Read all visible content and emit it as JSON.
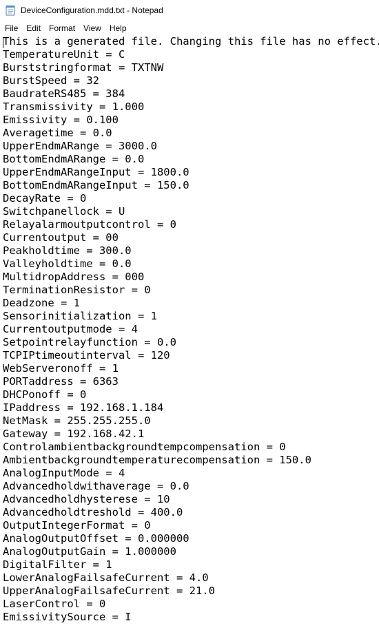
{
  "window": {
    "title": "DeviceConfiguration.mdd.txt - Notepad",
    "icon": "notepad-icon"
  },
  "menu": {
    "items": [
      "File",
      "Edit",
      "Format",
      "View",
      "Help"
    ]
  },
  "document": {
    "lines": [
      "This is a generated file. Changing this file has no effect.",
      "TemperatureUnit = C",
      "Burststringformat = TXTNW",
      "BurstSpeed = 32",
      "BaudrateRS485 = 384",
      "Transmissivity = 1.000",
      "Emissivity = 0.100",
      "Averagetime = 0.0",
      "UpperEndmARange = 3000.0",
      "BottomEndmARange = 0.0",
      "UpperEndmARangeInput = 1800.0",
      "BottomEndmARangeInput = 150.0",
      "DecayRate = 0",
      "Switchpanellock = U",
      "Relayalarmoutputcontrol = 0",
      "Currentoutput = 00",
      "Peakholdtime = 300.0",
      "Valleyholdtime = 0.0",
      "MultidropAddress = 000",
      "TerminationResistor = 0",
      "Deadzone = 1",
      "Sensorinitialization = 1",
      "Currentoutputmode = 4",
      "Setpointrelayfunction = 0.0",
      "TCPIPtimeoutinterval = 120",
      "WebServeronoff = 1",
      "PORTaddress = 6363",
      "DHCPonoff = 0",
      "IPaddress = 192.168.1.184",
      "NetMask = 255.255.255.0",
      "Gateway = 192.168.42.1",
      "Controlambientbackgroundtempcompensation = 0",
      "Ambientbackgroundtemperaturecompensation = 150.0",
      "AnalogInputMode = 4",
      "Advancedholdwithaverage = 0.0",
      "Advancedholdhysterese = 10",
      "Advancedholdtreshold = 400.0",
      "OutputIntegerFormat = 0",
      "AnalogOutputOffset = 0.000000",
      "AnalogOutputGain = 1.000000",
      "DigitalFilter = 1",
      "LowerAnalogFailsafeCurrent = 4.0",
      "UpperAnalogFailsafeCurrent = 21.0",
      "LaserControl = 0",
      "EmissivitySource = I"
    ]
  }
}
